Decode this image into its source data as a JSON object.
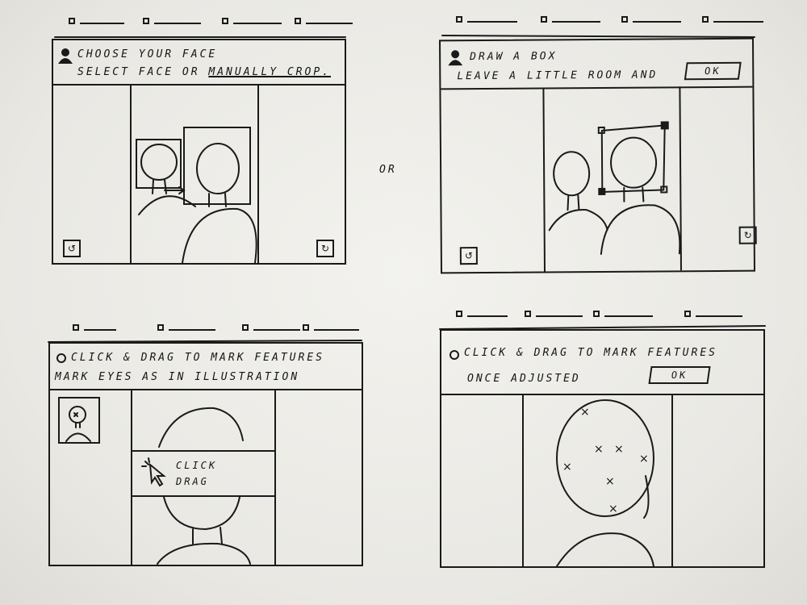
{
  "or_label": "OR",
  "panel1": {
    "title": "CHOOSE YOUR FACE",
    "subtitle_prefix": "SELECT FACE  OR ",
    "subtitle_link": "MANUALLY CROP."
  },
  "panel2": {
    "title": "DRAW A BOX",
    "subtitle": "LEAVE A LITTLE ROOM AND",
    "ok_label": "OK"
  },
  "panel3": {
    "title": "CLICK & DRAG TO MARK FEATURES",
    "subtitle": "MARK EYES AS IN ILLUSTRATION",
    "tooltip_click": "CLICK",
    "tooltip_drag": "DRAG"
  },
  "panel4": {
    "title": "CLICK & DRAG TO MARK FEATURES",
    "subtitle": "ONCE ADJUSTED",
    "ok_label": "OK"
  },
  "icons": {
    "person": "person-icon",
    "undo": "undo-icon",
    "redo": "redo-icon",
    "circle": "circle-icon",
    "cursor": "cursor-icon",
    "feature_marker": "x-mark"
  },
  "feature_marker_glyph": "×"
}
